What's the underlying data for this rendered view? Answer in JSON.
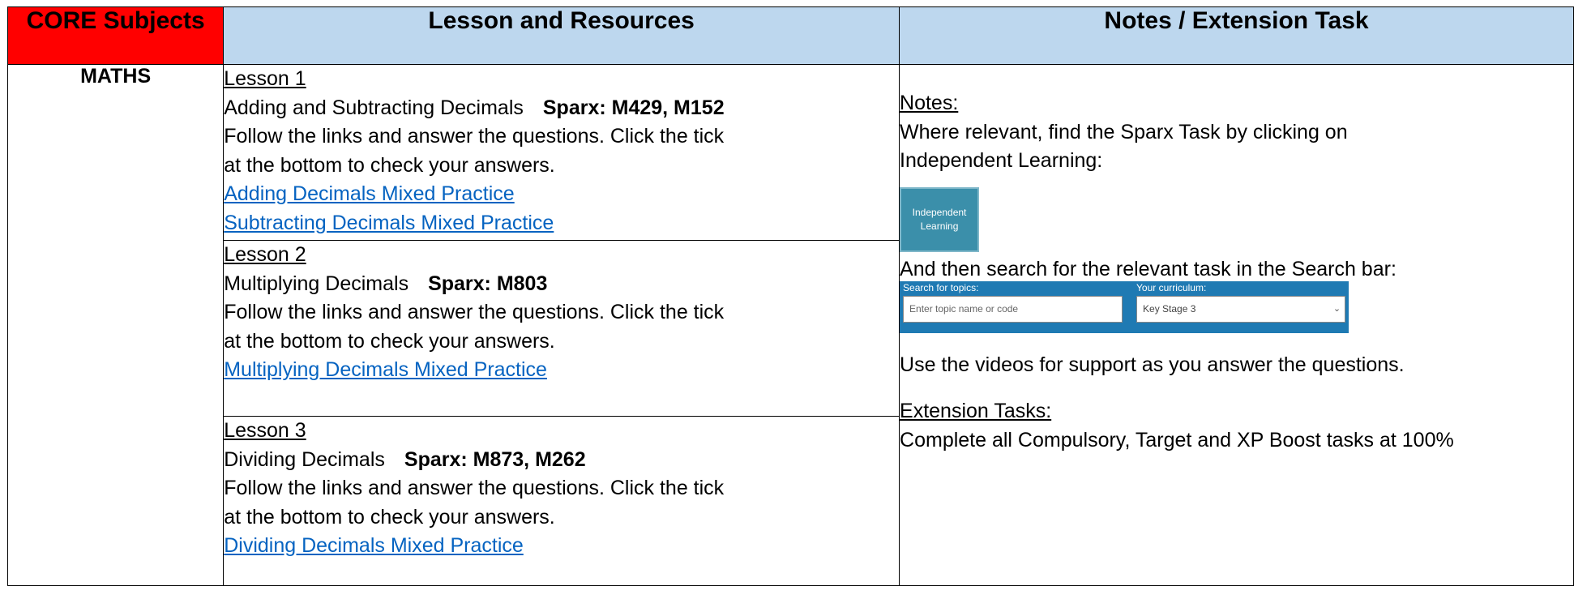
{
  "header": {
    "core": "CORE Subjects",
    "lessons": "Lesson and Resources",
    "notes": "Notes / Extension Task"
  },
  "subject": "MATHS",
  "lessons": [
    {
      "title": "Lesson 1",
      "topic": "Adding and Subtracting Decimals",
      "sparx": "Sparx: M429, M152",
      "instructions": "Follow the links and answer the questions. Click the tick at the bottom to check your answers.",
      "links": [
        "Adding Decimals Mixed Practice",
        "Subtracting Decimals Mixed Practice"
      ]
    },
    {
      "title": "Lesson 2",
      "topic": "Multiplying Decimals",
      "sparx": "Sparx: M803",
      "instructions": "Follow the links and answer the questions. Click the tick at the bottom to check your answers.",
      "links": [
        "Multiplying Decimals Mixed Practice"
      ]
    },
    {
      "title": "Lesson 3",
      "topic": "Dividing Decimals",
      "sparx": "Sparx: M873, M262",
      "instructions": "Follow the links and answer the questions. Click the tick at the bottom to check your answers.",
      "links": [
        "Dividing Decimals Mixed Practice"
      ]
    }
  ],
  "notes": {
    "heading": "Notes:",
    "line1": "Where relevant, find the Sparx Task by clicking on Independent Learning:",
    "il_button": "Independent Learning",
    "line2": "And then search for the relevant task in the Search bar:",
    "search": {
      "topics_label": "Search for topics:",
      "curriculum_label": "Your curriculum:",
      "placeholder": "Enter topic name or code",
      "curriculum_value": "Key Stage 3"
    },
    "line3": "Use the videos for support as you answer the questions.",
    "ext_heading": "Extension Tasks:",
    "ext_text": "Complete all Compulsory, Target and XP Boost tasks at 100%"
  },
  "colors": {
    "core_header_bg": "#ff0000",
    "header_bg": "#bdd7ee",
    "link": "#0563c1",
    "sparx_blue": "#1f7ab3",
    "il_button_bg": "#3b8faa"
  }
}
